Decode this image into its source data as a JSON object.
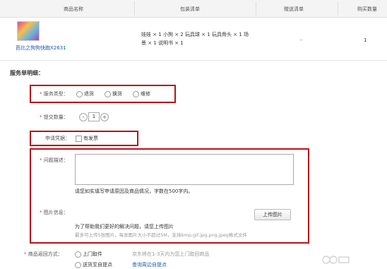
{
  "table": {
    "headers": [
      "商品名称",
      "包装清单",
      "赠送清单",
      "购买数量"
    ],
    "product": {
      "name": "芭比之狗狗快跑X2631",
      "contents_line1": "娃娃 × 1 小狗 × 2 玩具球 × 1 玩具骨头 × 1 场",
      "contents_line2": "景 × 1 说明书 × 1",
      "gift": "-",
      "quantity": "1"
    }
  },
  "section_title": "服务单明细：",
  "form": {
    "service_type": {
      "label": "服务类型：",
      "options": [
        "退货",
        "换货",
        "维修"
      ]
    },
    "submit_qty": {
      "label": "提交数量：",
      "minus": "-",
      "value": "1",
      "plus": "+"
    },
    "voucher": {
      "label": "申请凭据：",
      "option": "有发票"
    },
    "description": {
      "label": "问题描述：",
      "hint": "请您如实填写申请原因及商品情况，字数在500字内。"
    },
    "image_info": {
      "label": "图片信息：",
      "upload_button": "上传图片",
      "hint1": "为了帮助我们更好的解决问题，请您上传图片",
      "hint2": "最多可上传5张图片，每张图片大小不超过5M，支持bmp,gif,jpg,png,jpeg格式文件"
    },
    "return_method": {
      "label": "商品返回方式：",
      "option1": "上门取件",
      "option1_note": "京东将在1-3天内为您上门取回商品",
      "option2": "送货至自提点",
      "option2_link": "查询周边自提点"
    }
  }
}
